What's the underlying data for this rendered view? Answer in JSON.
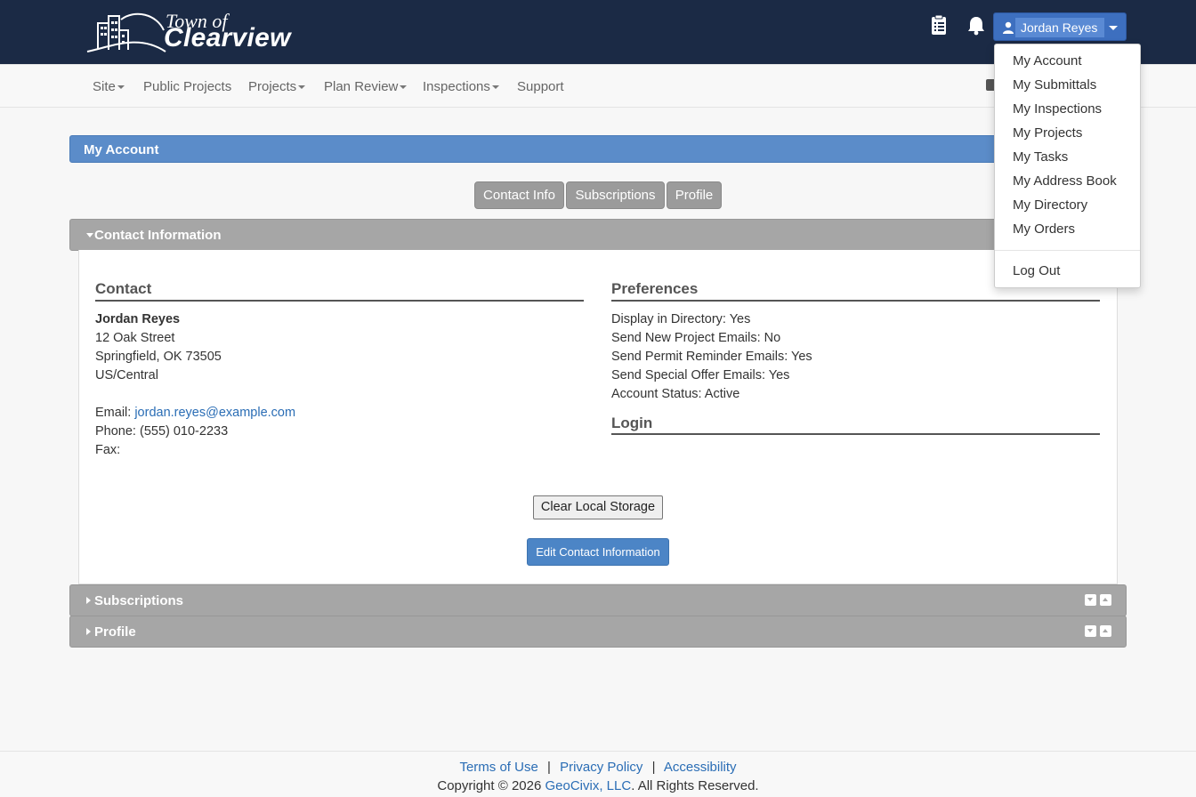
{
  "header": {
    "logo_top": "Town of",
    "logo_main": "Clearview",
    "user_name": "Jordan Reyes"
  },
  "nav": {
    "items": [
      {
        "label": "Site",
        "has_caret": true
      },
      {
        "label": "Public Projects",
        "has_caret": false
      },
      {
        "label": "Projects",
        "has_caret": true
      },
      {
        "label": "Plan Review",
        "has_caret": true
      },
      {
        "label": "Inspections",
        "has_caret": true
      },
      {
        "label": "Support",
        "has_caret": false
      }
    ]
  },
  "account": {
    "title": "My Account",
    "tabs": [
      "Contact Info",
      "Subscriptions",
      "Profile"
    ]
  },
  "panels": {
    "contact_info": "Contact Information",
    "subscriptions": "Subscriptions",
    "profile": "Profile"
  },
  "contact": {
    "heading": "Contact",
    "name": "Jordan Reyes",
    "street": "12 Oak Street",
    "city_line": "Springfield, OK 73505",
    "timezone": "US/Central",
    "email_label": "Email: ",
    "email": "jordan.reyes@example.com",
    "phone": "Phone: (555) 010-2233",
    "fax": "Fax:"
  },
  "preferences": {
    "heading": "Preferences",
    "lines": [
      "Display in Directory: Yes",
      "Send New Project Emails: No",
      "Send Permit Reminder Emails: Yes",
      "Send Special Offer Emails: Yes",
      "Account Status: Active"
    ],
    "login_heading": "Login"
  },
  "buttons": {
    "clear_storage": "Clear Local Storage",
    "edit_contact": "Edit Contact Information"
  },
  "user_menu": {
    "items": [
      "My Account",
      "My Submittals",
      "My Inspections",
      "My Projects",
      "My Tasks",
      "My Address Book",
      "My Directory",
      "My Orders"
    ],
    "logout": "Log Out"
  },
  "footer": {
    "terms": "Terms of Use",
    "privacy": "Privacy Policy",
    "accessibility": "Accessibility",
    "sep": "|",
    "copy_prefix": "Copyright © 2026 ",
    "company": "GeoCivix, LLC",
    "copy_suffix": ". All Rights Reserved."
  },
  "colors": {
    "header_bg": "#1b2a45",
    "accent": "#5b8cc9",
    "panel_gray": "#a6a6a6",
    "link": "#2a6db5"
  }
}
